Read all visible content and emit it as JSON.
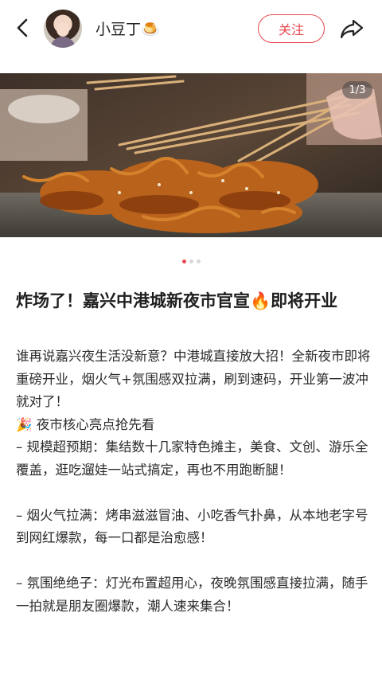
{
  "header": {
    "username": "小豆丁🍮",
    "follow_label": "关注"
  },
  "media": {
    "counter": "1/3",
    "current_page": 1,
    "total_pages": 3
  },
  "post": {
    "title": "炸场了！嘉兴中港城新夜市官宣🔥即将开业",
    "paragraphs": [
      "谁再说嘉兴夜生活没新意？中港城直接放大招！全新夜市即将重磅开业，烟火气+氛围感双拉满，刷到速码，开业第一波冲就对了！",
      "🎉 夜市核心亮点抢先看",
      "– 规模超预期：集结数十几家特色摊主，美食、文创、游乐全覆盖，逛吃遛娃一站式搞定，再也不用跑断腿！",
      "– 烟火气拉满：烤串滋滋冒油、小吃香气扑鼻，从本地老字号到网红爆款，每一口都是治愈感！",
      "– 氛围绝绝子：灯光布置超用心，夜晚氛围感直接拉满，随手一拍就是朋友圈爆款，潮人速来集合！"
    ]
  },
  "colors": {
    "accent": "#e8474f",
    "text": "#2b2b2b"
  },
  "icons": {
    "back": "chevron-left-icon",
    "share": "share-arrow-icon"
  }
}
